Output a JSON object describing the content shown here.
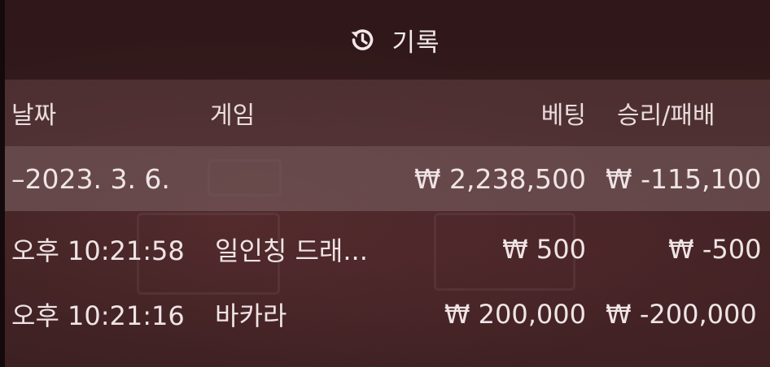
{
  "header": {
    "icon": "history-icon",
    "title": "기록"
  },
  "columns": {
    "date": "날짜",
    "game": "게임",
    "bet": "베팅",
    "win_loss": "승리/패배"
  },
  "summary": {
    "date": "–2023. 3. 6.",
    "bet": "₩ 2,238,500",
    "win_loss": "₩ -115,100"
  },
  "rows": [
    {
      "time": "오후 10:21:58",
      "game": "일인칭 드래...",
      "bet": "₩ 500",
      "win_loss": "₩ -500"
    },
    {
      "time": "오후 10:21:16",
      "game": "바카라",
      "bet": "₩ 200,000",
      "win_loss": "₩ -200,000"
    }
  ]
}
